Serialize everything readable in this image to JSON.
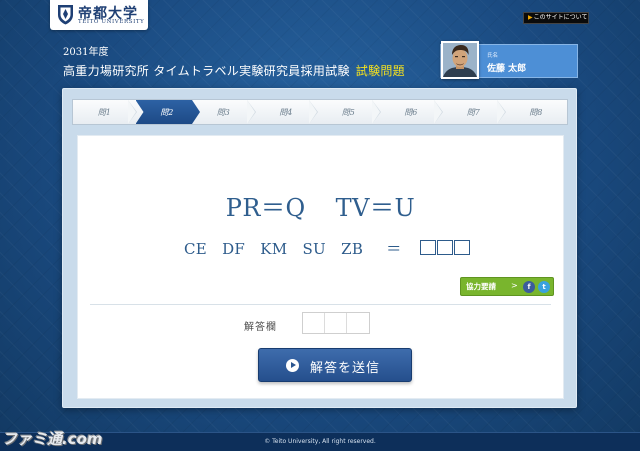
{
  "header": {
    "logo_jp": "帝都大学",
    "logo_en": "TEITO UNIVERSITY",
    "about_link": "このサイトについて",
    "year": "2031年度",
    "exam_title": "高重力場研究所 タイムトラベル実験研究員採用試験",
    "exam_highlight": "試験問題"
  },
  "user": {
    "label": "氏名",
    "name": "佐藤 太郎"
  },
  "steps": [
    {
      "label": "問1",
      "active": false
    },
    {
      "label": "問2",
      "active": true
    },
    {
      "label": "問3",
      "active": false
    },
    {
      "label": "問4",
      "active": false
    },
    {
      "label": "問5",
      "active": false
    },
    {
      "label": "問6",
      "active": false
    },
    {
      "label": "問7",
      "active": false
    },
    {
      "label": "問8",
      "active": false
    }
  ],
  "question": {
    "formula_a": "PR＝Q",
    "formula_b": "TV＝U",
    "sequence": [
      "CE",
      "DF",
      "KM",
      "SU",
      "ZB"
    ],
    "equals": "＝",
    "answer_slots": 3
  },
  "share": {
    "label": "協力要請",
    "arrow": ">",
    "facebook_glyph": "f",
    "twitter_glyph": "t"
  },
  "answer": {
    "label": "解答欄",
    "value": "",
    "cells": 3
  },
  "submit": {
    "label": "解答を送信"
  },
  "footer": {
    "copyright": "© Teito University, All right reserved."
  },
  "watermark": "ファミ通.com",
  "colors": {
    "accent": "#2a5a96",
    "highlight": "#f3e020",
    "share_green": "#79b52d",
    "facebook": "#3b5c9b",
    "twitter": "#3aa2de"
  }
}
